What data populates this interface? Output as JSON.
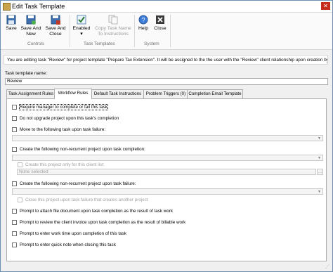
{
  "window": {
    "title": "Edit Task Template",
    "close_glyph": "✕"
  },
  "ribbon": {
    "save": "Save",
    "save_new": [
      "Save And",
      "New"
    ],
    "save_close": [
      "Save And",
      "Close"
    ],
    "enabled": "Enabled",
    "copy_task_name": [
      "Copy Task Name",
      "To Instructions"
    ],
    "help": "Help",
    "close": "Close",
    "groups": {
      "controls": "Controls",
      "task_templates": "Task Templates",
      "system": "System"
    }
  },
  "info_message": "You are editing task \"Review\" for project template \"Prepare Tax Extension\". It will be assigned to the the user with the \"Review\" client relationship upon creation by default.",
  "task_template_name": {
    "label": "Task template name:",
    "value": "Review"
  },
  "tabs": [
    {
      "label": "Task Assignment Rules"
    },
    {
      "label": "Workflow Rules"
    },
    {
      "label": "Default Task Instructions"
    },
    {
      "label": "Problem Triggers (0)"
    },
    {
      "label": "Completion Email Template"
    }
  ],
  "workflow": {
    "require_manager": "Require manager to complete or fail this task",
    "no_upgrade": "Do not upgrade project upon this task's completion",
    "move_on_failure": "Move to the following task upon task failure:",
    "create_on_completion": "Create the following non-recurrent project upon task completion:",
    "only_for_client": "Create this project only for this client list:",
    "none_selected": "None selected",
    "create_on_failure": "Create the following non-recurrent project upon task failure:",
    "close_on_failure": "Close this project upon task failure that creates another project",
    "prompt_attach": "Prompt to attach file document upon task completion as the result of task work",
    "prompt_review_invoice": "Prompt to review the client invoice upon task completion as the result of billable work",
    "prompt_work_time": "Prompt to enter work time upon completion of this task",
    "prompt_quick_note": "Prompt to enter quick note when closing this task",
    "ellipsis": "..."
  }
}
